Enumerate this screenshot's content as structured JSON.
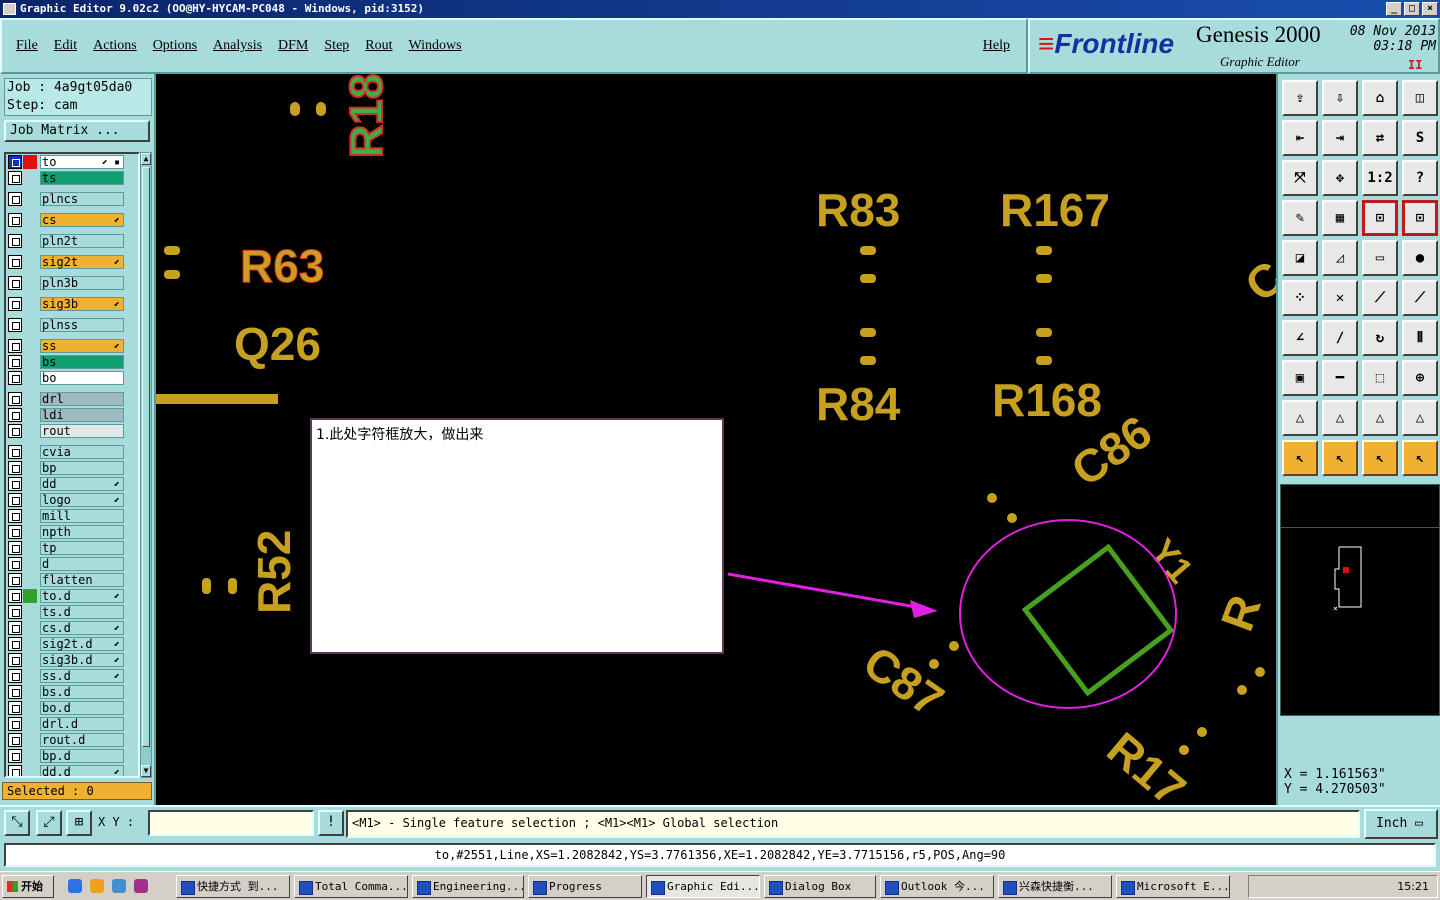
{
  "window": {
    "title": "Graphic Editor 9.02c2 (OO@HY-HYCAM-PC048 - Windows, pid:3152)"
  },
  "menu": {
    "items": [
      "File",
      "Edit",
      "Actions",
      "Options",
      "Analysis",
      "DFM",
      "Step",
      "Rout",
      "Windows"
    ],
    "help": "Help"
  },
  "brand": {
    "logo": "Frontline",
    "product": "Genesis 2000",
    "subtitle": "Graphic Editor",
    "date": "08 Nov 2013",
    "time": "03:18 PM",
    "pause": "II"
  },
  "job": {
    "job_line": "Job : 4a9gt05da0",
    "step_line": "Step: cam",
    "matrix_button": "Job Matrix ..."
  },
  "layers": [
    {
      "name": "to",
      "bg": "#ffffff",
      "marker": "⬋ ▪",
      "active": true,
      "colorchip": "#e01010"
    },
    {
      "name": "ts",
      "bg": "#10a070",
      "marker": ""
    },
    {
      "name": "plncs",
      "bg": "#a8dcdc",
      "marker": "",
      "gap": true
    },
    {
      "name": "cs",
      "bg": "#f0b030",
      "marker": "⬋",
      "gap": true
    },
    {
      "name": "pln2t",
      "bg": "#a8dcdc",
      "marker": "",
      "gap": true
    },
    {
      "name": "sig2t",
      "bg": "#f0b030",
      "marker": "⬋",
      "gap": true
    },
    {
      "name": "pln3b",
      "bg": "#a8dcdc",
      "marker": "",
      "gap": true
    },
    {
      "name": "sig3b",
      "bg": "#f0b030",
      "marker": "⬋",
      "gap": true
    },
    {
      "name": "plnss",
      "bg": "#a8dcdc",
      "marker": "",
      "gap": true
    },
    {
      "name": "ss",
      "bg": "#f0b030",
      "marker": "⬋",
      "gap": true
    },
    {
      "name": "bs",
      "bg": "#10a070",
      "marker": ""
    },
    {
      "name": "bo",
      "bg": "#ffffff",
      "marker": ""
    },
    {
      "name": "drl",
      "bg": "#a0b8c0",
      "marker": "",
      "gap": true
    },
    {
      "name": "ldi",
      "bg": "#a0b8c0",
      "marker": ""
    },
    {
      "name": "rout",
      "bg": "#e0e8e8",
      "marker": ""
    },
    {
      "name": "cvia",
      "bg": "#a8dcdc",
      "marker": "",
      "gap": true
    },
    {
      "name": "bp",
      "bg": "#a8dcdc",
      "marker": ""
    },
    {
      "name": "dd",
      "bg": "#a8dcdc",
      "marker": "⬋"
    },
    {
      "name": "logo",
      "bg": "#a8dcdc",
      "marker": "⬋"
    },
    {
      "name": "mill",
      "bg": "#a8dcdc",
      "marker": ""
    },
    {
      "name": "npth",
      "bg": "#a8dcdc",
      "marker": ""
    },
    {
      "name": "tp",
      "bg": "#a8dcdc",
      "marker": ""
    },
    {
      "name": "d",
      "bg": "#a8dcdc",
      "marker": ""
    },
    {
      "name": "flatten",
      "bg": "#a8dcdc",
      "marker": ""
    },
    {
      "name": "to.d",
      "bg": "#a8dcdc",
      "marker": "⬋",
      "colorchip": "#30a030"
    },
    {
      "name": "ts.d",
      "bg": "#a8dcdc",
      "marker": ""
    },
    {
      "name": "cs.d",
      "bg": "#a8dcdc",
      "marker": "⬋"
    },
    {
      "name": "sig2t.d",
      "bg": "#a8dcdc",
      "marker": "⬋"
    },
    {
      "name": "sig3b.d",
      "bg": "#a8dcdc",
      "marker": "⬋"
    },
    {
      "name": "ss.d",
      "bg": "#a8dcdc",
      "marker": "⬋"
    },
    {
      "name": "bs.d",
      "bg": "#a8dcdc",
      "marker": ""
    },
    {
      "name": "bo.d",
      "bg": "#a8dcdc",
      "marker": ""
    },
    {
      "name": "drl.d",
      "bg": "#a8dcdc",
      "marker": ""
    },
    {
      "name": "rout.d",
      "bg": "#a8dcdc",
      "marker": ""
    },
    {
      "name": "bp.d",
      "bg": "#a8dcdc",
      "marker": ""
    },
    {
      "name": "dd.d",
      "bg": "#a8dcdc",
      "marker": "⬋"
    }
  ],
  "selected": "Selected : 0",
  "canvas": {
    "labels": [
      "R83",
      "R167",
      "R63",
      "Q26",
      "R84",
      "R168",
      "C86",
      "R52",
      "C87",
      "R17",
      "Y1"
    ],
    "annotation": "1.此处字符框放大，做出来"
  },
  "tools": [
    "export-icon",
    "import-icon",
    "home-icon",
    "split-icon",
    "left-icon",
    "right-icon",
    "swap-icon",
    "s-icon",
    "fit-icon",
    "center-icon",
    "1:2",
    "help-icon",
    "brush-icon",
    "grid-icon",
    "snap-icon",
    "snap2-icon",
    "pad-icon",
    "line-icon",
    "ruler-icon",
    "dot-icon",
    "net-icon",
    "x-icon",
    "arc-icon",
    "arc2-icon",
    "angle-icon",
    "slash-icon",
    "hook-icon",
    "bracket-icon",
    "sq-icon",
    "dash-icon",
    "measure-icon",
    "group-icon",
    "tri1-icon",
    "tri2-icon",
    "tri3-icon",
    "tri4-icon",
    "select-icon",
    "select2-icon",
    "select3-icon",
    "select4-icon"
  ],
  "tool_labels": {
    "ratio": "1:2"
  },
  "coords": {
    "x": "X = 1.161563\"",
    "y": "Y = 4.270503\""
  },
  "bottom": {
    "xy_label": "X Y :",
    "message": "<M1> - Single feature selection ; <M1><M1> Global selection",
    "unit": "Inch",
    "warn": "!"
  },
  "status": "to,#2551,Line,XS=1.2082842,YS=3.7761356,XE=1.2082842,YE=3.7715156,r5,POS,Ang=90",
  "taskbar": {
    "start": "开始",
    "tasks": [
      "快捷方式 到...",
      "Total Comma...",
      "Engineering...",
      "Progress",
      "Graphic Edi...",
      "Dialog Box",
      "Outlook 今...",
      "兴森快捷衡...",
      "Microsoft E..."
    ],
    "clock": "15:21"
  },
  "colors": {
    "panel": "#a8dcdc",
    "silkscreen": "#c8a020",
    "highlight": "#e020e0",
    "outline_green": "#48a020"
  }
}
